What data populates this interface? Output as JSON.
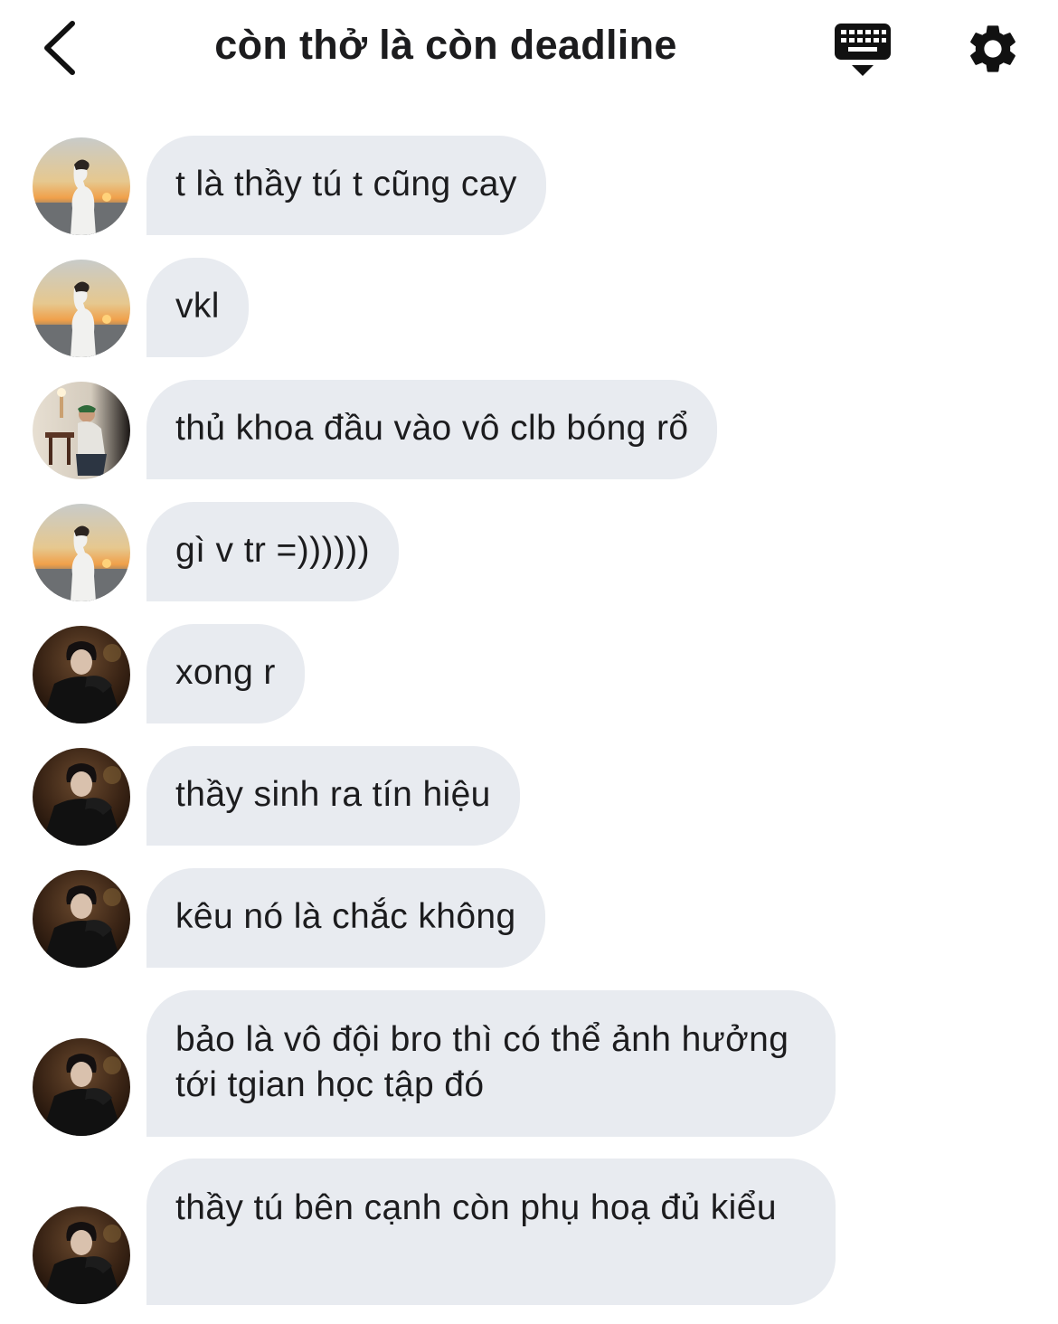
{
  "header": {
    "title": "còn thở là còn deadline",
    "back_icon": "chevron-left-icon",
    "keyboard_icon": "keyboard-hide-icon",
    "settings_icon": "gear-icon"
  },
  "messages": [
    {
      "text": "t là thầy tú t cũng cay",
      "avatar": "sunset-avatar"
    },
    {
      "text": "vkl",
      "avatar": "sunset-avatar"
    },
    {
      "text": "thủ khoa đầu vào vô clb bóng rổ",
      "avatar": "room-avatar"
    },
    {
      "text": "gì v tr =))))))",
      "avatar": "sunset-avatar"
    },
    {
      "text": "xong r",
      "avatar": "dark-avatar"
    },
    {
      "text": "thầy sinh ra tín hiệu",
      "avatar": "dark-avatar"
    },
    {
      "text": "kêu nó là chắc không",
      "avatar": "dark-avatar"
    },
    {
      "text": "bảo là vô đội bro thì có thể ảnh hưởng tới tgian học tập đó",
      "avatar": "dark-avatar"
    },
    {
      "text": "thầy tú bên cạnh còn phụ hoạ đủ kiểu",
      "avatar": "dark-avatar"
    }
  ],
  "colors": {
    "bubble": "#e8ebf0",
    "text": "#1c1c1e",
    "background": "#ffffff"
  }
}
